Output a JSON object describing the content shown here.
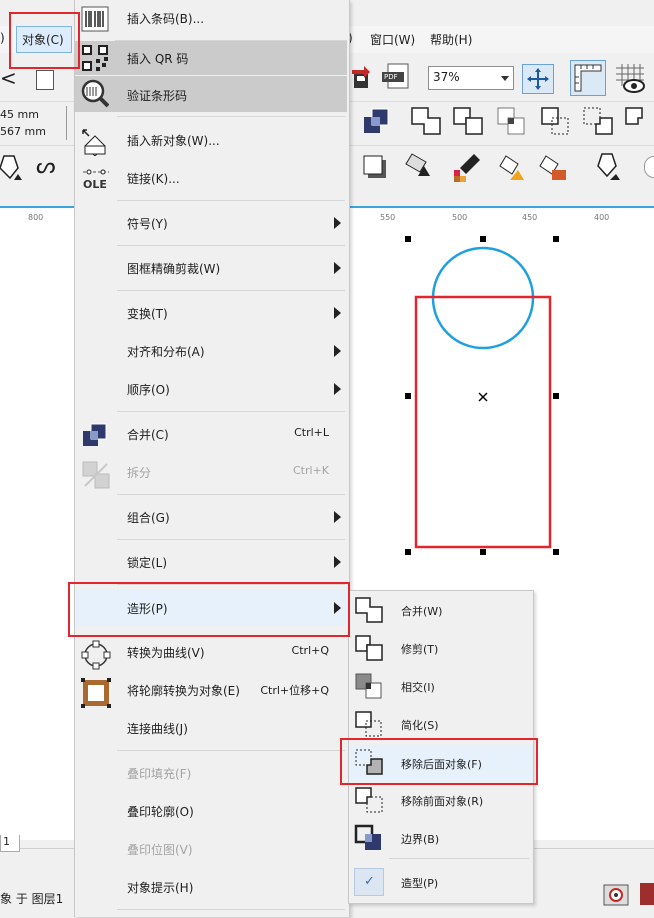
{
  "menubar": {
    "object_label": "对象(C)",
    "window_label": "窗口(W)",
    "help_label": "帮助(H)",
    "paren": ")"
  },
  "toolbar": {
    "zoom_value": "37%",
    "pdf_label": "PDF"
  },
  "propbar": {
    "width_value": "45 mm",
    "height_value": "567 mm"
  },
  "ruler": {
    "ticks": [
      "800",
      "550",
      "500",
      "450",
      "400"
    ]
  },
  "statusbar": {
    "layer_text": "象 于 图层1",
    "page_tab": "1"
  },
  "menu": {
    "items": [
      {
        "label": "插入条码(B)...",
        "icon": "barcode-icon"
      },
      {
        "label": "插入 QR 码",
        "icon": "qr-code-icon"
      },
      {
        "label": "验证条形码",
        "icon": "magnifier-icon"
      },
      {
        "label": "插入新对象(W)...",
        "icon": "insert-object-icon"
      },
      {
        "label": "链接(K)...",
        "icon": "ole-icon"
      },
      {
        "label": "符号(Y)"
      },
      {
        "label": "图框精确剪裁(W)"
      },
      {
        "label": "变换(T)"
      },
      {
        "label": "对齐和分布(A)"
      },
      {
        "label": "顺序(O)"
      },
      {
        "label": "合并(C)",
        "shortcut": "Ctrl+L",
        "icon": "combine-icon"
      },
      {
        "label": "拆分",
        "shortcut": "Ctrl+K",
        "icon": "break-apart-icon"
      },
      {
        "label": "组合(G)"
      },
      {
        "label": "锁定(L)"
      },
      {
        "label": "造形(P)"
      },
      {
        "label": "转换为曲线(V)",
        "shortcut": "Ctrl+Q",
        "icon": "convert-curves-icon"
      },
      {
        "label": "将轮廓转换为对象(E)",
        "shortcut": "Ctrl+位移+Q",
        "icon": "outline-to-object-icon"
      },
      {
        "label": "连接曲线(J)"
      },
      {
        "label": "叠印填充(F)"
      },
      {
        "label": "叠印轮廓(O)"
      },
      {
        "label": "叠印位图(V)"
      },
      {
        "label": "对象提示(H)"
      }
    ]
  },
  "submenu": {
    "items": [
      {
        "label": "合并(W)",
        "icon": "weld-icon"
      },
      {
        "label": "修剪(T)",
        "icon": "trim-icon"
      },
      {
        "label": "相交(I)",
        "icon": "intersect-icon"
      },
      {
        "label": "简化(S)",
        "icon": "simplify-icon"
      },
      {
        "label": "移除后面对象(F)",
        "icon": "back-minus-front-icon"
      },
      {
        "label": "移除前面对象(R)",
        "icon": "front-minus-back-icon"
      },
      {
        "label": "边界(B)",
        "icon": "boundary-icon"
      },
      {
        "label": "造型(P)",
        "icon": "check-icon",
        "check": "✓"
      }
    ]
  },
  "colors": {
    "highlight_red": "#e1262d",
    "circle_blue": "#1fa0de",
    "menu_selection": "#e6f1fc",
    "menu_hover": "#cbcbcb"
  }
}
